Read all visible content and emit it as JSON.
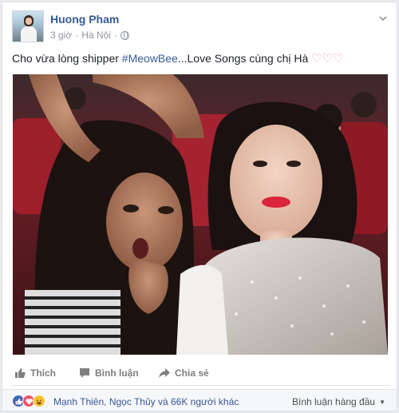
{
  "post": {
    "author": "Huong Pham",
    "time": "3 giờ",
    "separator": "·",
    "location": "Hà Nội",
    "privacy_icon": "globe-icon",
    "status_prefix": "Cho vừa lòng shipper ",
    "hashtag": "#MeowBee",
    "status_suffix": "...Love Songs cùng chị Hà ",
    "status_emoji": "♡♡♡",
    "photo_icon": "photo-of-two-women-selfie"
  },
  "actions": {
    "like": "Thích",
    "comment": "Bình luận",
    "share": "Chia sẻ"
  },
  "footer": {
    "reaction_icons": [
      "like-icon",
      "love-icon",
      "haha-icon"
    ],
    "reactors": "Mạnh Thiên, Ngọc Thủy và 66K người khác",
    "sort_label": "Bình luận hàng đầu"
  },
  "colors": {
    "link": "#365899",
    "meta": "#90949c",
    "like_blue": "#4267b2",
    "love_red": "#f25268"
  }
}
